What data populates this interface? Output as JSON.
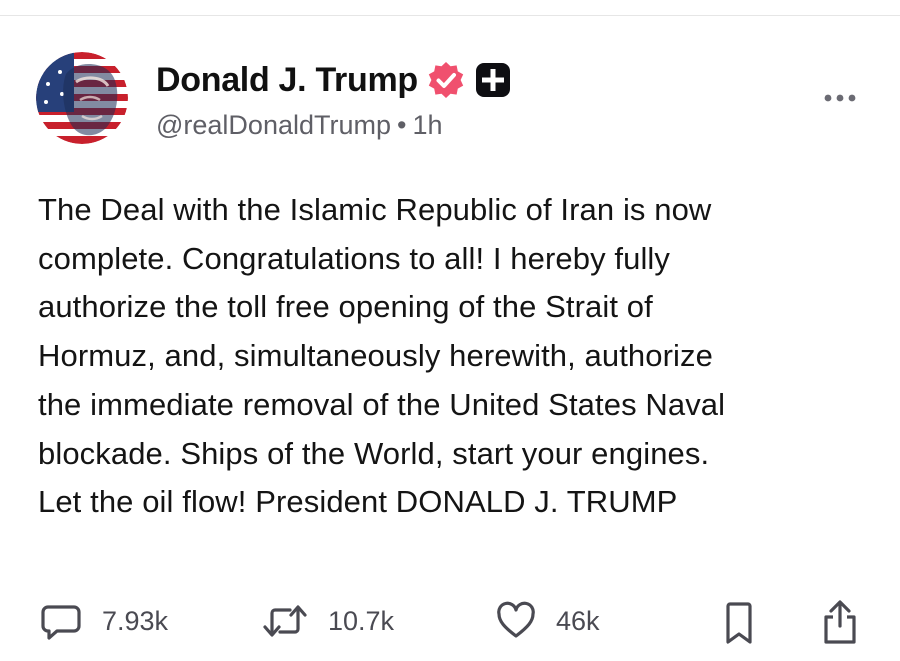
{
  "author": {
    "display_name": "Donald J. Trump",
    "handle": "@realDonaldTrump",
    "separator": "•",
    "time": "1h",
    "verified": true
  },
  "post": {
    "text": "The Deal with the Islamic Republic of Iran is now\ncomplete. Congratulations to all! I hereby fully\nauthorize the toll free opening of the Strait of\nHormuz, and, simultaneously herewith, authorize\nthe immediate removal of the United States Naval\nblockade. Ships of the World, start your engines.\nLet the oil flow! President DONALD J. TRUMP"
  },
  "actions": {
    "replies": "7.93k",
    "reposts": "10.7k",
    "likes": "46k"
  },
  "icons": {
    "verified": "verified-badge-icon",
    "plus": "plus-badge-icon",
    "more": "more-dots-icon",
    "reply": "comment-icon",
    "repost": "repost-icon",
    "like": "heart-icon",
    "bookmark": "bookmark-icon",
    "share": "share-icon"
  },
  "colors": {
    "verified_badge": "#f0506e",
    "text_primary": "#141414",
    "text_secondary": "#5f5f66",
    "icon": "#4a4a52"
  }
}
